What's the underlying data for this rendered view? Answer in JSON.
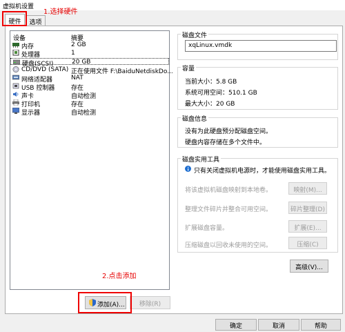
{
  "window": {
    "title": "虚拟机设置"
  },
  "annotations": {
    "step1": "1.选择硬件",
    "step2": "2.点击添加"
  },
  "tabs": [
    {
      "label": "硬件"
    },
    {
      "label": "选项"
    }
  ],
  "device_table": {
    "headers": {
      "device": "设备",
      "summary": "摘要"
    },
    "rows": [
      {
        "icon": "memory-icon",
        "name": "内存",
        "summary": "2 GB"
      },
      {
        "icon": "processor-icon",
        "name": "处理器",
        "summary": "1"
      },
      {
        "icon": "harddisk-icon",
        "name": "硬盘(SCSI)",
        "summary": "20 GB"
      },
      {
        "icon": "cdrom-icon",
        "name": "CD/DVD (SATA)",
        "summary": "正在使用文件 F:\\BaiduNetdiskDo..."
      },
      {
        "icon": "network-icon",
        "name": "网络适配器",
        "summary": "NAT"
      },
      {
        "icon": "usb-icon",
        "name": "USB 控制器",
        "summary": "存在"
      },
      {
        "icon": "sound-icon",
        "name": "声卡",
        "summary": "自动检测"
      },
      {
        "icon": "printer-icon",
        "name": "打印机",
        "summary": "存在"
      },
      {
        "icon": "display-icon",
        "name": "显示器",
        "summary": "自动检测"
      }
    ]
  },
  "disk_file": {
    "title": "磁盘文件",
    "value": "xqLinux.vmdk"
  },
  "capacity": {
    "title": "容量",
    "current": "当前大小：5.8 GB",
    "available": "系统可用空间：510.1 GB",
    "max": "最大大小：20 GB"
  },
  "disk_info": {
    "title": "磁盘信息",
    "line1": "没有为此硬盘预分配磁盘空间。",
    "line2": "硬盘内容存储在多个文件中。"
  },
  "disk_utils": {
    "title": "磁盘实用工具",
    "notice": "只有关闭虚拟机电源时，才能使用磁盘实用工具。",
    "map_desc": "将该虚拟机磁盘映射到本地卷。",
    "map_btn": "映射(M)...",
    "defrag_desc": "整理文件碎片并整合可用空间。",
    "defrag_btn": "碎片整理(D)",
    "expand_desc": "扩展磁盘容量。",
    "expand_btn": "扩展(E)...",
    "compact_desc": "压缩磁盘以回收未使用的空间。",
    "compact_btn": "压缩(C)"
  },
  "advanced_btn": "高级(V)...",
  "add_btn": "添加(A)...",
  "remove_btn": "移除(R)",
  "footer": {
    "ok": "确定",
    "cancel": "取消",
    "help": "帮助"
  },
  "colors": {
    "annotation": "#e60000",
    "highlight_box": "#ee0000",
    "info_icon": "#1f6fd1"
  }
}
